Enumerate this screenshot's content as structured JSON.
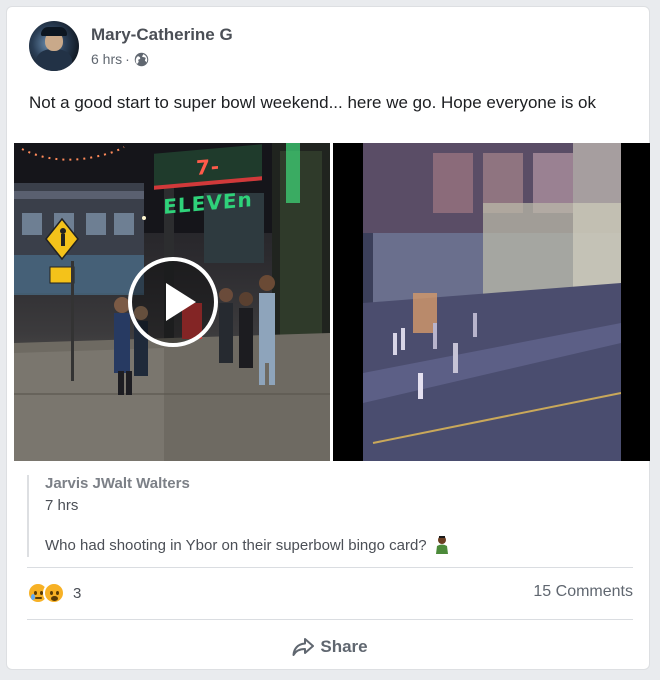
{
  "post": {
    "author": "Mary-Catherine G",
    "time": "6 hrs",
    "separator": "·",
    "privacy_icon": "globe-icon",
    "text": "Not a good start to super bowl weekend... here we go. Hope everyone is ok"
  },
  "media": {
    "left_video": {
      "sign_text_seven": "7-",
      "sign_text_rest": "ELEVEn",
      "play_icon": "play-icon"
    },
    "right_video": {}
  },
  "shared": {
    "author": "Jarvis JWalt Walters",
    "time": "7 hrs",
    "text": "Who had shooting in Ybor on their superbowl bingo card?",
    "emoji_icon": "person-emoji-icon"
  },
  "footer": {
    "reaction_icons": [
      "sad-reaction-icon",
      "wow-reaction-icon"
    ],
    "reaction_count": "3",
    "comments": "15 Comments",
    "share_label": "Share",
    "share_icon": "share-arrow-icon"
  },
  "colors": {
    "page_bg": "#e9ebee",
    "card_bg": "#ffffff",
    "muted_text": "#606770",
    "reaction_yellow": "#f7b125"
  }
}
